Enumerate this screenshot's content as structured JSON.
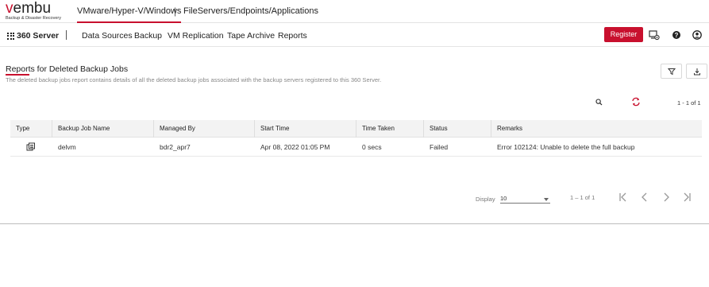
{
  "brand": {
    "logo_text": "vembu",
    "tagline": "Backup & Disaster Recovery",
    "accent_color": "#c8102e"
  },
  "product_tabs": [
    {
      "label": "VMware/Hyper-V/Windows",
      "active": true
    },
    {
      "label": "FileServers/Endpoints/Applications",
      "active": false
    }
  ],
  "product_separator": "|",
  "nav": {
    "app_name": "360 Server",
    "items": [
      "Data Sources",
      "Backup",
      "VM Replication",
      "Tape Archive",
      "Reports"
    ],
    "register_label": "Register",
    "icons": [
      "settings-monitor-icon",
      "help-icon",
      "user-icon"
    ]
  },
  "page": {
    "title": "Reports for Deleted Backup Jobs",
    "description": "The deleted backup jobs report contains details of all the deleted backup jobs associated with the backup servers registered to this 360 Server.",
    "tools": [
      "filter-icon",
      "download-icon"
    ]
  },
  "toolbar": {
    "page_count": "1 - 1 of 1"
  },
  "table": {
    "columns": [
      "Type",
      "Backup Job Name",
      "Managed By",
      "Start Time",
      "Time Taken",
      "Status",
      "Remarks"
    ],
    "rows": [
      {
        "type_icon": "vm-backup-icon",
        "job_name": "delvm",
        "managed_by": "bdr2_apr7",
        "start_time": "Apr 08, 2022 01:05 PM",
        "time_taken": "0 secs",
        "status": "Failed",
        "remarks": "Error 102124: Unable to delete the full backup"
      }
    ]
  },
  "pagination": {
    "display_label": "Display",
    "page_size": "10",
    "range": "1 – 1 of 1"
  }
}
